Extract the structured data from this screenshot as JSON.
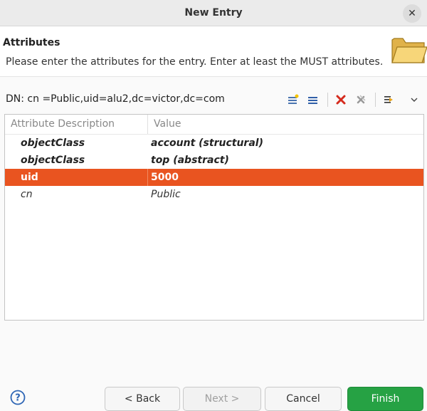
{
  "window": {
    "title": "New Entry"
  },
  "header": {
    "title": "Attributes",
    "description": "Please enter the attributes for the entry. Enter at least the MUST attributes."
  },
  "dn": {
    "text": "DN: cn =Public,uid=alu2,dc=victor,dc=com"
  },
  "toolbar": {
    "icons": [
      "new-attribute-icon",
      "new-value-icon",
      "delete-icon",
      "delete-all-icon",
      "quick-filter-icon",
      "view-menu-chevron-icon"
    ]
  },
  "table": {
    "columns": [
      "Attribute Description",
      "Value"
    ],
    "rows": [
      {
        "attribute": "objectClass",
        "value": "account (structural)"
      },
      {
        "attribute": "objectClass",
        "value": "top (abstract)"
      },
      {
        "attribute": "uid",
        "value": "5000"
      },
      {
        "attribute": "cn",
        "value": "Public"
      }
    ]
  },
  "buttons": {
    "back": "< Back",
    "next": "Next >",
    "cancel": "Cancel",
    "finish": "Finish"
  },
  "colors": {
    "selection": "#e95420",
    "finish": "#26a244"
  }
}
